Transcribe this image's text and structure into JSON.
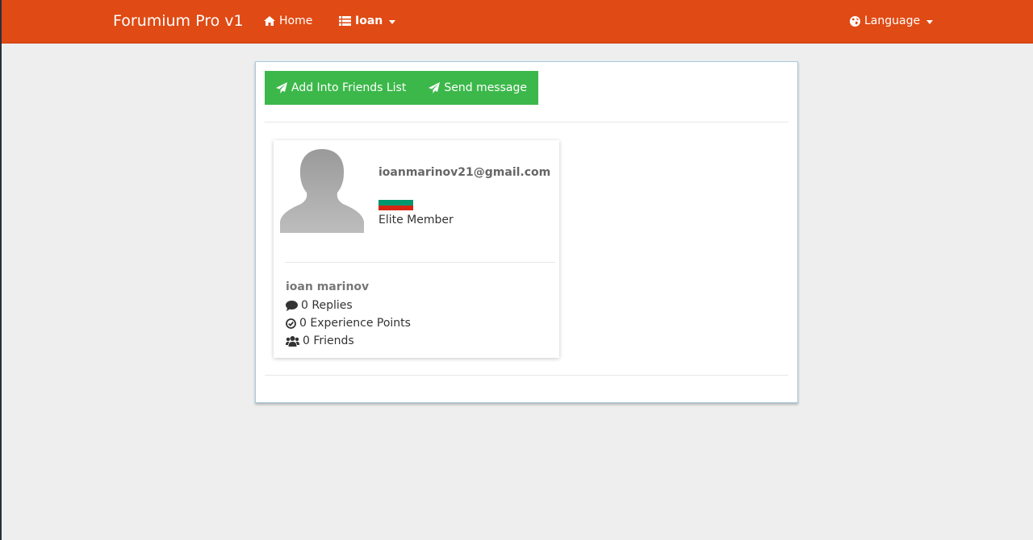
{
  "navbar": {
    "brand": "Forumium Pro v1",
    "home_label": "Home",
    "user_label": "Ioan",
    "language_label": "Language",
    "bg_color": "#e04a14"
  },
  "actions": {
    "add_friend_label": "Add Into Friends List",
    "send_message_label": "Send message",
    "button_color": "#3cb84a"
  },
  "profile": {
    "email": "ioanmarinov21@gmail.com",
    "flag_colors": [
      "#ffffff",
      "#00966e",
      "#d62612"
    ],
    "rank": "Elite Member",
    "name": "ioan marinov",
    "replies": "0 Replies",
    "experience": "0 Experience Points",
    "friends": "0 Friends"
  },
  "icons": {
    "home": "home-icon",
    "user_menu": "list-icon",
    "language": "globe-icon",
    "add_friend": "paper-plane-icon",
    "send_message": "paper-plane-icon",
    "replies": "comment-icon",
    "experience": "check-circle-icon",
    "friends": "users-icon"
  }
}
